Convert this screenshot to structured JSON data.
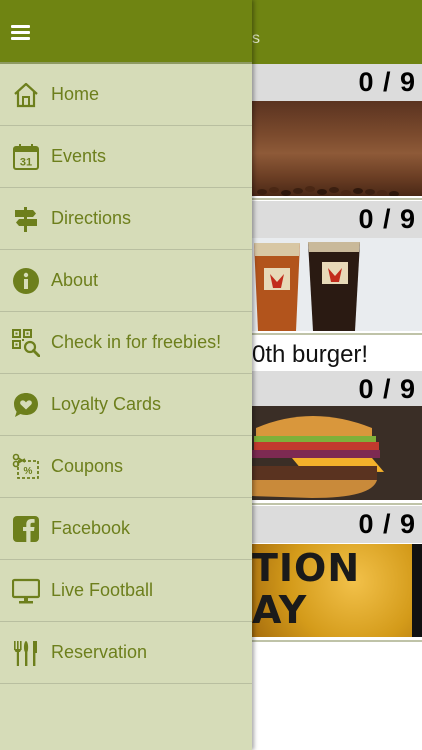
{
  "app": {
    "header_title_partial": "s",
    "accent_color": "#6f8412",
    "drawer_bg": "#d6dcb8"
  },
  "drawer": {
    "items": [
      {
        "label": "Home",
        "icon": "home-icon"
      },
      {
        "label": "Events",
        "icon": "calendar-icon",
        "icon_text": "31"
      },
      {
        "label": "Directions",
        "icon": "signpost-icon"
      },
      {
        "label": "About",
        "icon": "info-icon"
      },
      {
        "label": "Check in for freebies!",
        "icon": "qr-search-icon"
      },
      {
        "label": "Loyalty Cards",
        "icon": "heart-chat-icon"
      },
      {
        "label": "Coupons",
        "icon": "coupon-scissors-icon"
      },
      {
        "label": "Facebook",
        "icon": "facebook-icon"
      },
      {
        "label": "Live Football",
        "icon": "monitor-icon"
      },
      {
        "label": "Reservation",
        "icon": "cutlery-icon"
      }
    ]
  },
  "cards": [
    {
      "count": "0 / 9",
      "image": "coffee"
    },
    {
      "count": "0 / 9",
      "image": "beer"
    },
    {
      "title_partial": "0th burger!",
      "count": "0 / 9",
      "image": "burger"
    },
    {
      "count": "0 / 9",
      "image": "event",
      "image_text_line1": "TION",
      "image_text_line2": "AY"
    }
  ]
}
